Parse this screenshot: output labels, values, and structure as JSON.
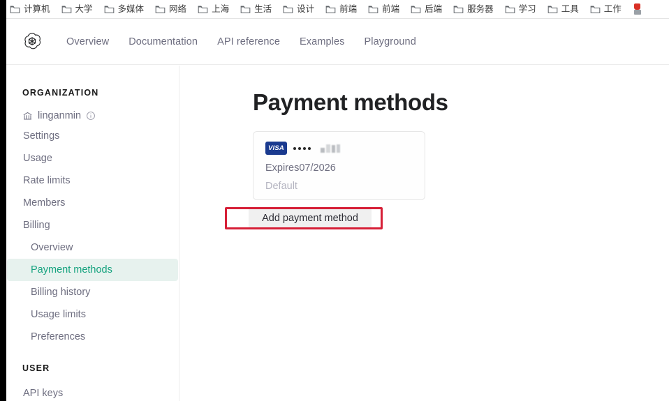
{
  "browser": {
    "bookmarks": [
      {
        "label": "计算机",
        "icon": "folder-icon"
      },
      {
        "label": "大学",
        "icon": "folder-icon"
      },
      {
        "label": "多媒体",
        "icon": "folder-icon"
      },
      {
        "label": "网络",
        "icon": "folder-icon"
      },
      {
        "label": "上海",
        "icon": "folder-icon"
      },
      {
        "label": "生活",
        "icon": "folder-icon"
      },
      {
        "label": "设计",
        "icon": "folder-icon"
      },
      {
        "label": "前端",
        "icon": "folder-icon"
      },
      {
        "label": "前端",
        "icon": "folder-icon"
      },
      {
        "label": "后端",
        "icon": "folder-icon"
      },
      {
        "label": "服务器",
        "icon": "folder-icon"
      },
      {
        "label": "学习",
        "icon": "folder-icon"
      },
      {
        "label": "工具",
        "icon": "folder-icon"
      },
      {
        "label": "工作",
        "icon": "folder-icon"
      }
    ]
  },
  "header": {
    "logo_icon": "openai-logo-icon",
    "nav": [
      {
        "label": "Overview"
      },
      {
        "label": "Documentation"
      },
      {
        "label": "API reference"
      },
      {
        "label": "Examples"
      },
      {
        "label": "Playground"
      }
    ]
  },
  "sidebar": {
    "organization_title": "ORGANIZATION",
    "org": {
      "name": "linganmin",
      "building_icon": "bank-icon",
      "info_icon": "info-circle-icon"
    },
    "org_items": [
      {
        "label": "Settings",
        "active": false
      },
      {
        "label": "Usage",
        "active": false
      },
      {
        "label": "Rate limits",
        "active": false
      },
      {
        "label": "Members",
        "active": false
      },
      {
        "label": "Billing",
        "active": false
      }
    ],
    "billing_items": [
      {
        "label": "Overview",
        "active": false
      },
      {
        "label": "Payment methods",
        "active": true
      },
      {
        "label": "Billing history",
        "active": false
      },
      {
        "label": "Usage limits",
        "active": false
      },
      {
        "label": "Preferences",
        "active": false
      }
    ],
    "user_title": "USER",
    "user_items": [
      {
        "label": "API keys",
        "active": false
      }
    ],
    "active_color": "#16a37f",
    "active_bg": "#e7f2ee"
  },
  "main": {
    "page_title": "Payment methods",
    "card": {
      "brand": "VISA",
      "masked_prefix": "••••",
      "masked_digits_redacted": true,
      "expires_label": "Expires07/2026",
      "default_label": "Default"
    },
    "add_payment_button": "Add payment method",
    "annotation": {
      "type": "highlight-rectangle",
      "color": "#d61f37",
      "target": "add-payment-method-button"
    }
  }
}
